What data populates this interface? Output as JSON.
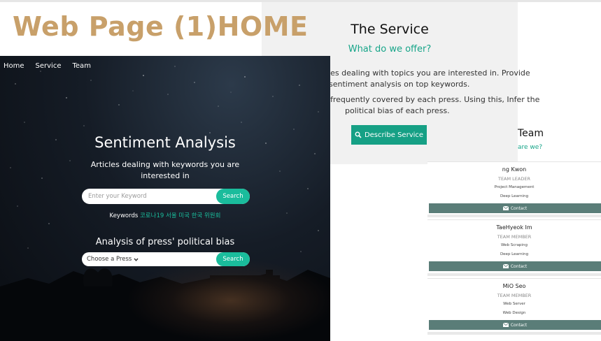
{
  "page_label": "Web Page (1)HOME",
  "service": {
    "title": "The Service",
    "subtitle": "What do we offer?",
    "line1": "icles dealing with topics you are interested in. Provide",
    "line2": "sentiment analysis on top keywords.",
    "line3": "frequently covered by each press. Using this, Infer the",
    "line4": "political bias of each press.",
    "button_label": "Describe Service",
    "button_icon": "search-icon"
  },
  "nav": {
    "items": [
      "Home",
      "Service",
      "Team"
    ]
  },
  "hero": {
    "title": "Sentiment Analysis",
    "desc_line1": "Articles dealing with keywords you are",
    "desc_line2": "interested in",
    "search_placeholder": "Enter your Keyword",
    "search_button": "Search",
    "keywords_label": "Keywords",
    "keywords_values": "코로나19 서울 미국 한국 위원회",
    "press_title": "Analysis of press' political bias",
    "press_select_value": "Choose a Press",
    "press_button": "Search"
  },
  "team": {
    "title": "Team",
    "subtitle": "are we?",
    "members": [
      {
        "name": "ng Kwon",
        "role": "TEAM LEADER",
        "skills": [
          "Project Management",
          "Deep Learning"
        ],
        "contact": "Contact"
      },
      {
        "name": "TaeHyeok Im",
        "role": "TEAM MEMBER",
        "skills": [
          "Web Scraping",
          "Deep Learning"
        ],
        "contact": "Contact"
      },
      {
        "name": "MiO Seo",
        "role": "TEAM MEMBER",
        "skills": [
          "Web Server",
          "Web Design"
        ],
        "contact": "Contact"
      }
    ]
  },
  "colors": {
    "accent": "#1abc9c",
    "label": "#c8a06a",
    "contact": "#5a7d78"
  }
}
